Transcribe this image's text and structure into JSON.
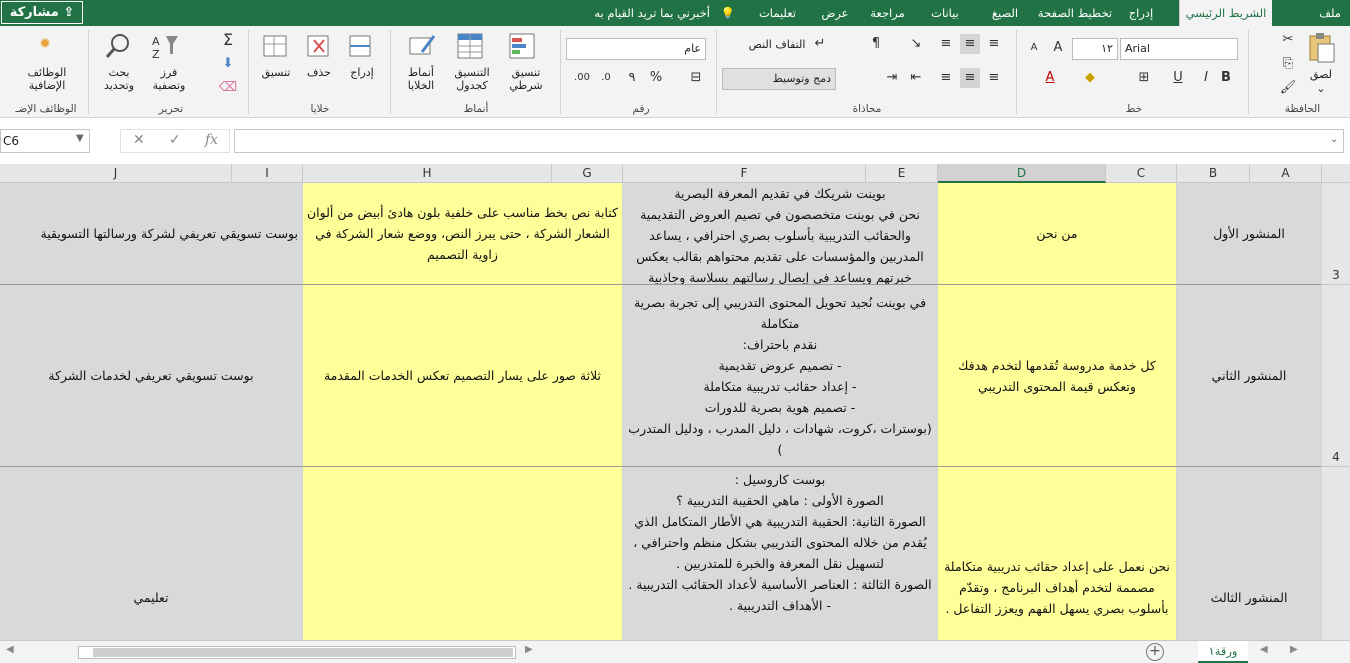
{
  "tabs": [
    "ملف",
    "الشريط الرئيسي",
    "إدراج",
    "تخطيط الصفحة",
    "الصيغ",
    "بيانات",
    "مراجعة",
    "عرض",
    "تعليمات"
  ],
  "tell_me": "أخبرني بما تريد القيام به",
  "share_label": "مشاركة",
  "ribbon": {
    "clipboard": {
      "group": "الحافظة",
      "paste": "لصق"
    },
    "font": {
      "group": "خط",
      "font_name": "Arial",
      "font_size": "١٢",
      "bold": "B",
      "italic": "I",
      "underline": "U"
    },
    "alignment": {
      "group": "محاذاة",
      "wrap_text": "التفاف النص",
      "merge_center": "دمج وتوسيط"
    },
    "number": {
      "group": "رقم",
      "format": "عام",
      "percent": "%",
      "comma": "٩"
    },
    "styles": {
      "group": "أنماط",
      "conditional": "تنسيق شرطي",
      "format_table": "التنسيق كجدول",
      "cell_styles": "أنماط الخلايا"
    },
    "cells": {
      "group": "خلايا",
      "insert": "إدراج",
      "delete": "حذف",
      "format": "تنسيق"
    },
    "editing": {
      "group": "تحرير",
      "sort_filter": "فرز وتصفية",
      "find_select": "بحث وتحديد"
    },
    "addins": {
      "group": "الوظائف الإضـ",
      "label": "الوظائف الإضافية"
    }
  },
  "name_box": "C6",
  "fx_label": "fx",
  "columns": [
    "A",
    "B",
    "C",
    "D",
    "E",
    "F",
    "G",
    "H",
    "I",
    "J"
  ],
  "rows": [
    {
      "num": "3",
      "a_b": "المنشور الأول",
      "c_d": "من نحن",
      "e_f": "بوينت شريكك في تقديم المعرفة البصرية\nنحن في بوينت متخصصون في تصيم العروض التقديمية والحقائب التدريبية بأسلوب بصري احترافي ، يساعد المدربين والمؤسسات على تقديم محتواهم بقالب يعكس خبرتهم ويساعد في إيصال رسالتهم بسلاسة وجاذبية",
      "g_h": "كتابة نص بخط مناسب على خلفية بلون هادئ أبيض من ألوان الشعار الشركة ، حتى يبرز النص، ووضع شعار الشركة في زاوية التصميم",
      "i_j": "بوست تسويقي تعريفي لشركة ورسالتها التسويقية"
    },
    {
      "num": "4",
      "a_b": "المنشور الثاني",
      "c_d": "كل خدمة مدروسة تُقدمها لتخدم هدفك وتعكس قيمة المحتوى التدريبي",
      "e_f": "في بوينت نُجيد تحويل المحتوى التدريبي إلى تجربة بصرية متكاملة\nنقدم باحتراف:\n- تصميم عروض تقديمية\n- إعداد حقائب تدريبية متكاملة\n- تصميم هوية بصرية للدورات\n(بوسترات ،كروت، شهادات ، دليل المدرب ، ودليل المتدرب )",
      "g_h": "ثلاثة صور على يسار التصميم تعكس الخدمات المقدمة",
      "i_j": "بوست تسويقي تعريفي لخدمات الشركة"
    },
    {
      "num": "",
      "a_b": "المنشور الثالث",
      "c_d": "نحن نعمل على إعداد حقائب تدريبية متكاملة مصممة لتخدم أهداف البرنامج ، وتقدّم بأسلوب بصري يسهل الفهم ويعزز التفاعل .",
      "e_f": "بوست كاروسيل :\nالصورة الأولى : ماهي الحقيبة التدريبية ؟\nالصورة الثانية: الحقيبة التدريبية هي الأطار المتكامل الذي يُقدم من خلاله المحتوى التدريبي بشكل منظم واحترافي ، لتسهيل نقل المعرفة والخبرة للمتدربين .\nالصورة الثالثة : العناصر الأساسية لأعداد الحقائب التدريبية .\n- الأهداف التدريبية .",
      "g_h": "",
      "i_j": "تعليمي"
    }
  ],
  "sheet_tab": "ورقة١"
}
